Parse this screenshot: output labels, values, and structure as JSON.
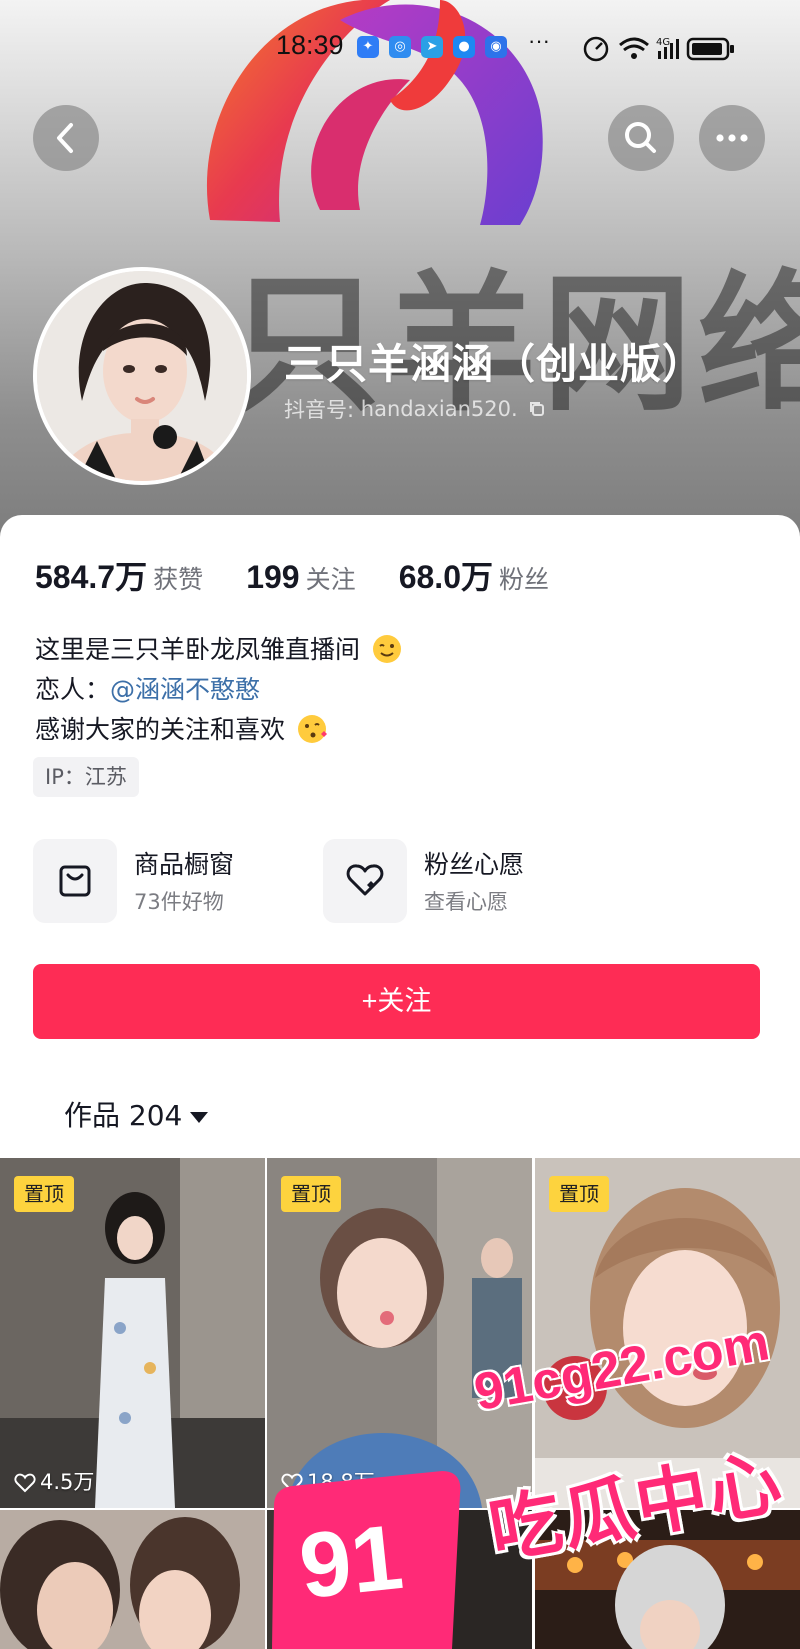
{
  "status_bar": {
    "time": "18:39",
    "more": "···",
    "network_label": "4G"
  },
  "banner": {
    "watermark_text": "只羊网络"
  },
  "profile": {
    "name": "三只羊涵涵（创业版）",
    "id_label": "抖音号:",
    "id_value": "handaxian520."
  },
  "stats": [
    {
      "value": "584.7万",
      "label": "获赞"
    },
    {
      "value": "199",
      "label": "关注"
    },
    {
      "value": "68.0万",
      "label": "粉丝"
    }
  ],
  "bio": {
    "line1": "这里是三只羊卧龙凤雏直播间",
    "line2_prefix": "恋人：",
    "line2_mention": "@涵涵不憨憨",
    "line3": "感谢大家的关注和喜欢"
  },
  "ip_tag": "IP：江苏",
  "features": [
    {
      "title": "商品橱窗",
      "subtitle": "73件好物",
      "icon": "shopping-bag-icon"
    },
    {
      "title": "粉丝心愿",
      "subtitle": "查看心愿",
      "icon": "heart-wish-icon"
    }
  ],
  "follow_button": "+关注",
  "works_tab": "作品 204",
  "videos": [
    {
      "pinned": "置顶",
      "likes": "4.5万"
    },
    {
      "pinned": "置顶",
      "likes": "18.8万"
    },
    {
      "pinned": "置顶",
      "likes": ""
    }
  ],
  "overlay_watermark": {
    "url": "91cg22.com",
    "text": "吃瓜中心",
    "badge": "91"
  },
  "colors": {
    "accent": "#fe2c55",
    "mention": "#3c6fa8",
    "pin_badge": "#fdd33e",
    "watermark": "#ff2a77"
  }
}
